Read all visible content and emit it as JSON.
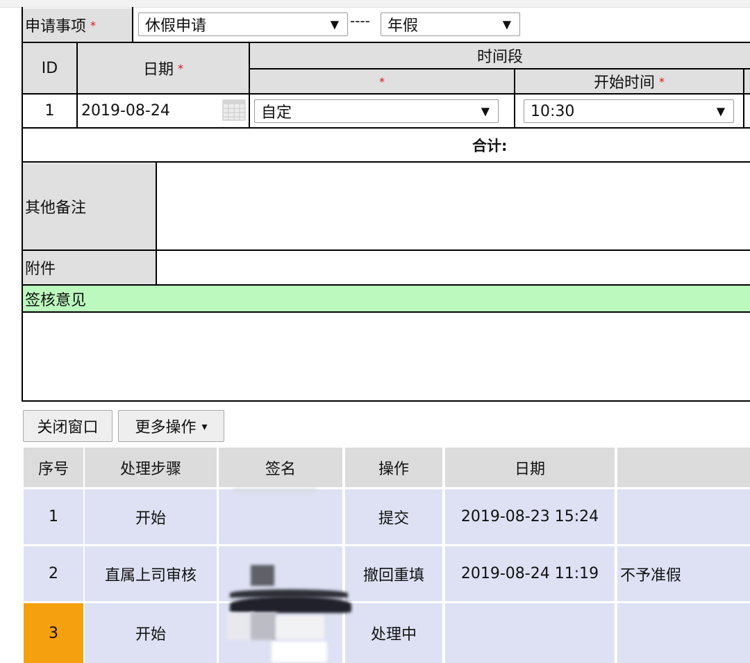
{
  "form": {
    "apply_label": "申请事项",
    "apply_type": "休假申请",
    "dash": "----",
    "leave_type": "年假",
    "col_id": "ID",
    "col_date": "日期",
    "col_period": "时间段",
    "col_start": "开始时间",
    "row": {
      "id": "1",
      "date": "2019-08-24",
      "period": "自定",
      "start": "10:30"
    },
    "total_label": "合计:",
    "remarks_label": "其他备注",
    "attachment_label": "附件",
    "review_section": "签核意见",
    "required_mark": "*",
    "dropdown_glyph": "▼"
  },
  "actions": {
    "close_window": "关闭窗口",
    "more_actions": "更多操作",
    "more_caret": "▾"
  },
  "flow": {
    "headers": [
      "序号",
      "处理步骤",
      "签名",
      "操作",
      "日期",
      ""
    ],
    "rows": [
      {
        "no": "1",
        "step": "开始",
        "op": "提交",
        "date": "2019-08-23 15:24",
        "note": ""
      },
      {
        "no": "2",
        "step": "直属上司审核",
        "op": "撤回重填",
        "date": "2019-08-24 11:19",
        "note": "不予准假"
      },
      {
        "no": "3",
        "step": "开始",
        "op": "处理中",
        "date": "",
        "note": ""
      }
    ]
  },
  "colors": {
    "current_step": "#f5a00e",
    "row_bg": "#dde1f3",
    "review_bg": "#bcf9bf",
    "header_bg": "#e0e0e0"
  }
}
